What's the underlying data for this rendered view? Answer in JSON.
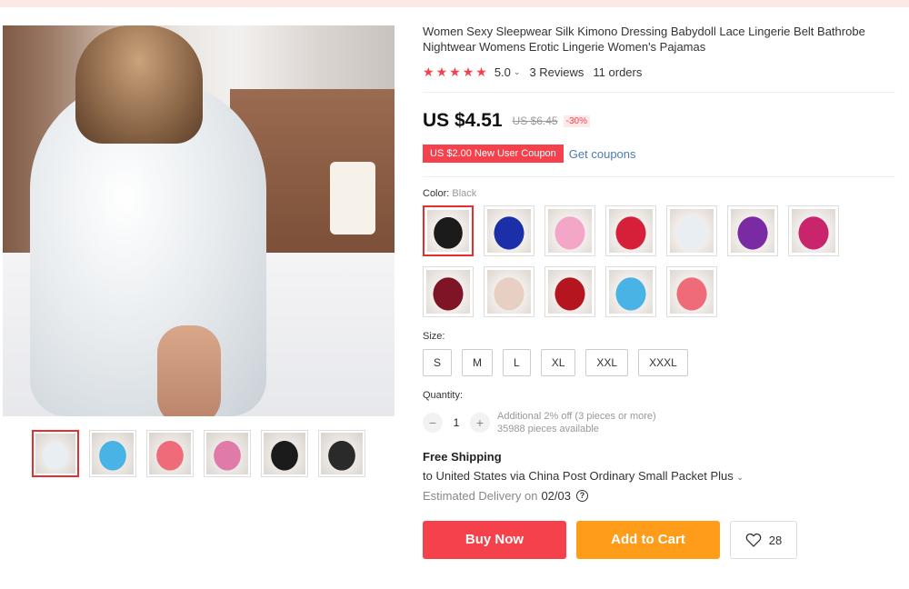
{
  "product": {
    "title": "Women Sexy Sleepwear Silk Kimono Dressing Babydoll Lace Lingerie Belt Bathrobe Nightwear Womens Erotic Lingerie Women's Pajamas",
    "rating": "5.0",
    "rating_caret": "⌄",
    "reviews": "3 Reviews",
    "orders": "11 orders"
  },
  "pricing": {
    "price": "US $4.51",
    "old_price": "US $6.45",
    "discount": "-30%",
    "coupon": "US $2.00 New User Coupon",
    "coupon_link": "Get coupons"
  },
  "color": {
    "label": "Color:",
    "selected": "Black",
    "swatches": [
      {
        "name": "black",
        "color": "#1b1b1b"
      },
      {
        "name": "blue",
        "color": "#1b2fa8"
      },
      {
        "name": "pink-light",
        "color": "#f3a6c7"
      },
      {
        "name": "red",
        "color": "#d6203a"
      },
      {
        "name": "white",
        "color": "#e9eef2"
      },
      {
        "name": "purple",
        "color": "#7a2aa3"
      },
      {
        "name": "rose",
        "color": "#c8256c"
      },
      {
        "name": "wine",
        "color": "#7e1426"
      },
      {
        "name": "beige",
        "color": "#e8cfc4"
      },
      {
        "name": "dark-red",
        "color": "#b4151e"
      },
      {
        "name": "sky-blue",
        "color": "#48b3e4"
      },
      {
        "name": "watermelon",
        "color": "#f06b7a"
      }
    ]
  },
  "size": {
    "label": "Size:",
    "options": [
      "S",
      "M",
      "L",
      "XL",
      "XXL",
      "XXXL"
    ]
  },
  "quantity": {
    "label": "Quantity:",
    "value": "1",
    "minus": "−",
    "plus": "+",
    "note": "Additional 2% off (3 pieces or more)",
    "available": "35988 pieces available"
  },
  "shipping": {
    "title": "Free Shipping",
    "line": "to United States via China Post Ordinary Small Packet Plus",
    "caret": "⌄",
    "delivery_label": "Estimated Delivery on",
    "delivery_date": "02/03",
    "help": "?"
  },
  "actions": {
    "buy_now": "Buy Now",
    "add_to_cart": "Add to Cart",
    "wishlist_count": "28"
  },
  "thumbnails": [
    {
      "name": "white",
      "color": "#e9eef2"
    },
    {
      "name": "sky-blue",
      "color": "#48b3e4"
    },
    {
      "name": "watermelon",
      "color": "#f06b7a"
    },
    {
      "name": "pink",
      "color": "#e07aa9"
    },
    {
      "name": "black-1",
      "color": "#1b1b1b"
    },
    {
      "name": "black-2",
      "color": "#2a2a2a"
    }
  ],
  "colors": {
    "accent": "#f5414b",
    "cart": "#ff9c1a",
    "link": "#4b7bb3"
  }
}
